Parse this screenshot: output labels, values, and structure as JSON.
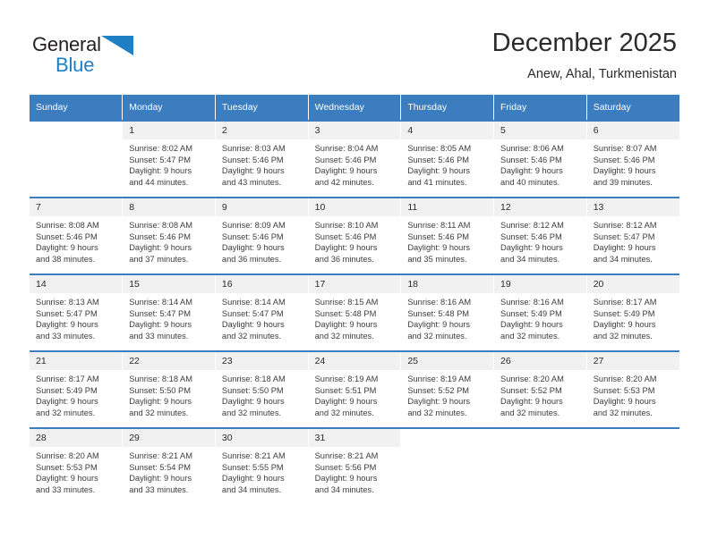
{
  "brand": {
    "name_part1": "General",
    "name_part2": "Blue",
    "logo_icon": "triangle-icon",
    "color_dark": "#231f20",
    "color_blue": "#1f7fc4"
  },
  "header": {
    "title": "December 2025",
    "subtitle": "Anew, Ahal, Turkmenistan"
  },
  "theme": {
    "header_bg": "#3b7dbf",
    "daynum_bg": "#f1f1f1",
    "text": "#3c3c3c"
  },
  "weekdays": [
    "Sunday",
    "Monday",
    "Tuesday",
    "Wednesday",
    "Thursday",
    "Friday",
    "Saturday"
  ],
  "weeks": [
    [
      {
        "day": "",
        "sunrise": "",
        "sunset": "",
        "daylight_line1": "",
        "daylight_line2": ""
      },
      {
        "day": "1",
        "sunrise": "Sunrise: 8:02 AM",
        "sunset": "Sunset: 5:47 PM",
        "daylight_line1": "Daylight: 9 hours",
        "daylight_line2": "and 44 minutes."
      },
      {
        "day": "2",
        "sunrise": "Sunrise: 8:03 AM",
        "sunset": "Sunset: 5:46 PM",
        "daylight_line1": "Daylight: 9 hours",
        "daylight_line2": "and 43 minutes."
      },
      {
        "day": "3",
        "sunrise": "Sunrise: 8:04 AM",
        "sunset": "Sunset: 5:46 PM",
        "daylight_line1": "Daylight: 9 hours",
        "daylight_line2": "and 42 minutes."
      },
      {
        "day": "4",
        "sunrise": "Sunrise: 8:05 AM",
        "sunset": "Sunset: 5:46 PM",
        "daylight_line1": "Daylight: 9 hours",
        "daylight_line2": "and 41 minutes."
      },
      {
        "day": "5",
        "sunrise": "Sunrise: 8:06 AM",
        "sunset": "Sunset: 5:46 PM",
        "daylight_line1": "Daylight: 9 hours",
        "daylight_line2": "and 40 minutes."
      },
      {
        "day": "6",
        "sunrise": "Sunrise: 8:07 AM",
        "sunset": "Sunset: 5:46 PM",
        "daylight_line1": "Daylight: 9 hours",
        "daylight_line2": "and 39 minutes."
      }
    ],
    [
      {
        "day": "7",
        "sunrise": "Sunrise: 8:08 AM",
        "sunset": "Sunset: 5:46 PM",
        "daylight_line1": "Daylight: 9 hours",
        "daylight_line2": "and 38 minutes."
      },
      {
        "day": "8",
        "sunrise": "Sunrise: 8:08 AM",
        "sunset": "Sunset: 5:46 PM",
        "daylight_line1": "Daylight: 9 hours",
        "daylight_line2": "and 37 minutes."
      },
      {
        "day": "9",
        "sunrise": "Sunrise: 8:09 AM",
        "sunset": "Sunset: 5:46 PM",
        "daylight_line1": "Daylight: 9 hours",
        "daylight_line2": "and 36 minutes."
      },
      {
        "day": "10",
        "sunrise": "Sunrise: 8:10 AM",
        "sunset": "Sunset: 5:46 PM",
        "daylight_line1": "Daylight: 9 hours",
        "daylight_line2": "and 36 minutes."
      },
      {
        "day": "11",
        "sunrise": "Sunrise: 8:11 AM",
        "sunset": "Sunset: 5:46 PM",
        "daylight_line1": "Daylight: 9 hours",
        "daylight_line2": "and 35 minutes."
      },
      {
        "day": "12",
        "sunrise": "Sunrise: 8:12 AM",
        "sunset": "Sunset: 5:46 PM",
        "daylight_line1": "Daylight: 9 hours",
        "daylight_line2": "and 34 minutes."
      },
      {
        "day": "13",
        "sunrise": "Sunrise: 8:12 AM",
        "sunset": "Sunset: 5:47 PM",
        "daylight_line1": "Daylight: 9 hours",
        "daylight_line2": "and 34 minutes."
      }
    ],
    [
      {
        "day": "14",
        "sunrise": "Sunrise: 8:13 AM",
        "sunset": "Sunset: 5:47 PM",
        "daylight_line1": "Daylight: 9 hours",
        "daylight_line2": "and 33 minutes."
      },
      {
        "day": "15",
        "sunrise": "Sunrise: 8:14 AM",
        "sunset": "Sunset: 5:47 PM",
        "daylight_line1": "Daylight: 9 hours",
        "daylight_line2": "and 33 minutes."
      },
      {
        "day": "16",
        "sunrise": "Sunrise: 8:14 AM",
        "sunset": "Sunset: 5:47 PM",
        "daylight_line1": "Daylight: 9 hours",
        "daylight_line2": "and 32 minutes."
      },
      {
        "day": "17",
        "sunrise": "Sunrise: 8:15 AM",
        "sunset": "Sunset: 5:48 PM",
        "daylight_line1": "Daylight: 9 hours",
        "daylight_line2": "and 32 minutes."
      },
      {
        "day": "18",
        "sunrise": "Sunrise: 8:16 AM",
        "sunset": "Sunset: 5:48 PM",
        "daylight_line1": "Daylight: 9 hours",
        "daylight_line2": "and 32 minutes."
      },
      {
        "day": "19",
        "sunrise": "Sunrise: 8:16 AM",
        "sunset": "Sunset: 5:49 PM",
        "daylight_line1": "Daylight: 9 hours",
        "daylight_line2": "and 32 minutes."
      },
      {
        "day": "20",
        "sunrise": "Sunrise: 8:17 AM",
        "sunset": "Sunset: 5:49 PM",
        "daylight_line1": "Daylight: 9 hours",
        "daylight_line2": "and 32 minutes."
      }
    ],
    [
      {
        "day": "21",
        "sunrise": "Sunrise: 8:17 AM",
        "sunset": "Sunset: 5:49 PM",
        "daylight_line1": "Daylight: 9 hours",
        "daylight_line2": "and 32 minutes."
      },
      {
        "day": "22",
        "sunrise": "Sunrise: 8:18 AM",
        "sunset": "Sunset: 5:50 PM",
        "daylight_line1": "Daylight: 9 hours",
        "daylight_line2": "and 32 minutes."
      },
      {
        "day": "23",
        "sunrise": "Sunrise: 8:18 AM",
        "sunset": "Sunset: 5:50 PM",
        "daylight_line1": "Daylight: 9 hours",
        "daylight_line2": "and 32 minutes."
      },
      {
        "day": "24",
        "sunrise": "Sunrise: 8:19 AM",
        "sunset": "Sunset: 5:51 PM",
        "daylight_line1": "Daylight: 9 hours",
        "daylight_line2": "and 32 minutes."
      },
      {
        "day": "25",
        "sunrise": "Sunrise: 8:19 AM",
        "sunset": "Sunset: 5:52 PM",
        "daylight_line1": "Daylight: 9 hours",
        "daylight_line2": "and 32 minutes."
      },
      {
        "day": "26",
        "sunrise": "Sunrise: 8:20 AM",
        "sunset": "Sunset: 5:52 PM",
        "daylight_line1": "Daylight: 9 hours",
        "daylight_line2": "and 32 minutes."
      },
      {
        "day": "27",
        "sunrise": "Sunrise: 8:20 AM",
        "sunset": "Sunset: 5:53 PM",
        "daylight_line1": "Daylight: 9 hours",
        "daylight_line2": "and 32 minutes."
      }
    ],
    [
      {
        "day": "28",
        "sunrise": "Sunrise: 8:20 AM",
        "sunset": "Sunset: 5:53 PM",
        "daylight_line1": "Daylight: 9 hours",
        "daylight_line2": "and 33 minutes."
      },
      {
        "day": "29",
        "sunrise": "Sunrise: 8:21 AM",
        "sunset": "Sunset: 5:54 PM",
        "daylight_line1": "Daylight: 9 hours",
        "daylight_line2": "and 33 minutes."
      },
      {
        "day": "30",
        "sunrise": "Sunrise: 8:21 AM",
        "sunset": "Sunset: 5:55 PM",
        "daylight_line1": "Daylight: 9 hours",
        "daylight_line2": "and 34 minutes."
      },
      {
        "day": "31",
        "sunrise": "Sunrise: 8:21 AM",
        "sunset": "Sunset: 5:56 PM",
        "daylight_line1": "Daylight: 9 hours",
        "daylight_line2": "and 34 minutes."
      },
      {
        "day": "",
        "sunrise": "",
        "sunset": "",
        "daylight_line1": "",
        "daylight_line2": ""
      },
      {
        "day": "",
        "sunrise": "",
        "sunset": "",
        "daylight_line1": "",
        "daylight_line2": ""
      },
      {
        "day": "",
        "sunrise": "",
        "sunset": "",
        "daylight_line1": "",
        "daylight_line2": ""
      }
    ]
  ]
}
